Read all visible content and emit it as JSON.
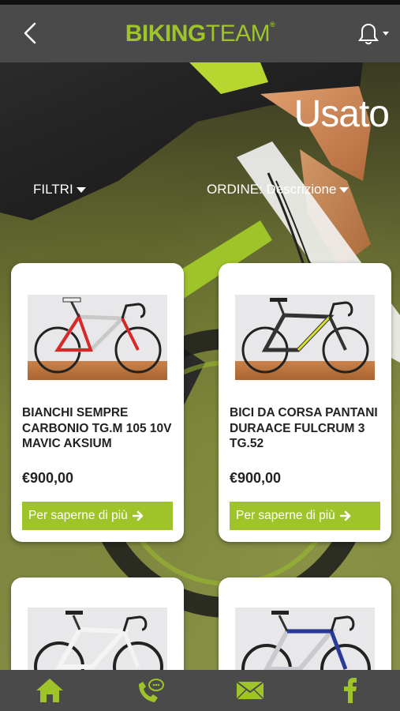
{
  "header": {
    "logo_part1": "BIKING",
    "logo_part2": "TEAM",
    "logo_mark": "®",
    "back_icon": "chevron-left-icon",
    "notification_icon": "bell-icon"
  },
  "page": {
    "title": "Usato",
    "filters_label": "FILTRI",
    "order_label": "ORDINE: Descrizione"
  },
  "products": [
    {
      "name": "BIANCHI SEMPRE CARBONIO TG.M 105 10V MAVIC AKSIUM",
      "price": "€900,00",
      "cta": "Per saperne di più"
    },
    {
      "name": "BICI DA CORSA PANTANI DURAACE FULCRUM 3 TG.52",
      "price": "€900,00",
      "cta": "Per saperne di più"
    },
    {
      "name": "",
      "price": "",
      "cta": ""
    },
    {
      "name": "",
      "price": "",
      "cta": ""
    }
  ],
  "bottom_nav": [
    {
      "icon": "home-icon"
    },
    {
      "icon": "phone-chat-icon"
    },
    {
      "icon": "mail-icon"
    },
    {
      "icon": "facebook-icon"
    }
  ],
  "colors": {
    "accent": "#9ec42a",
    "bar": "#4a4a4a",
    "card": "#ffffff",
    "text": "#222222"
  }
}
